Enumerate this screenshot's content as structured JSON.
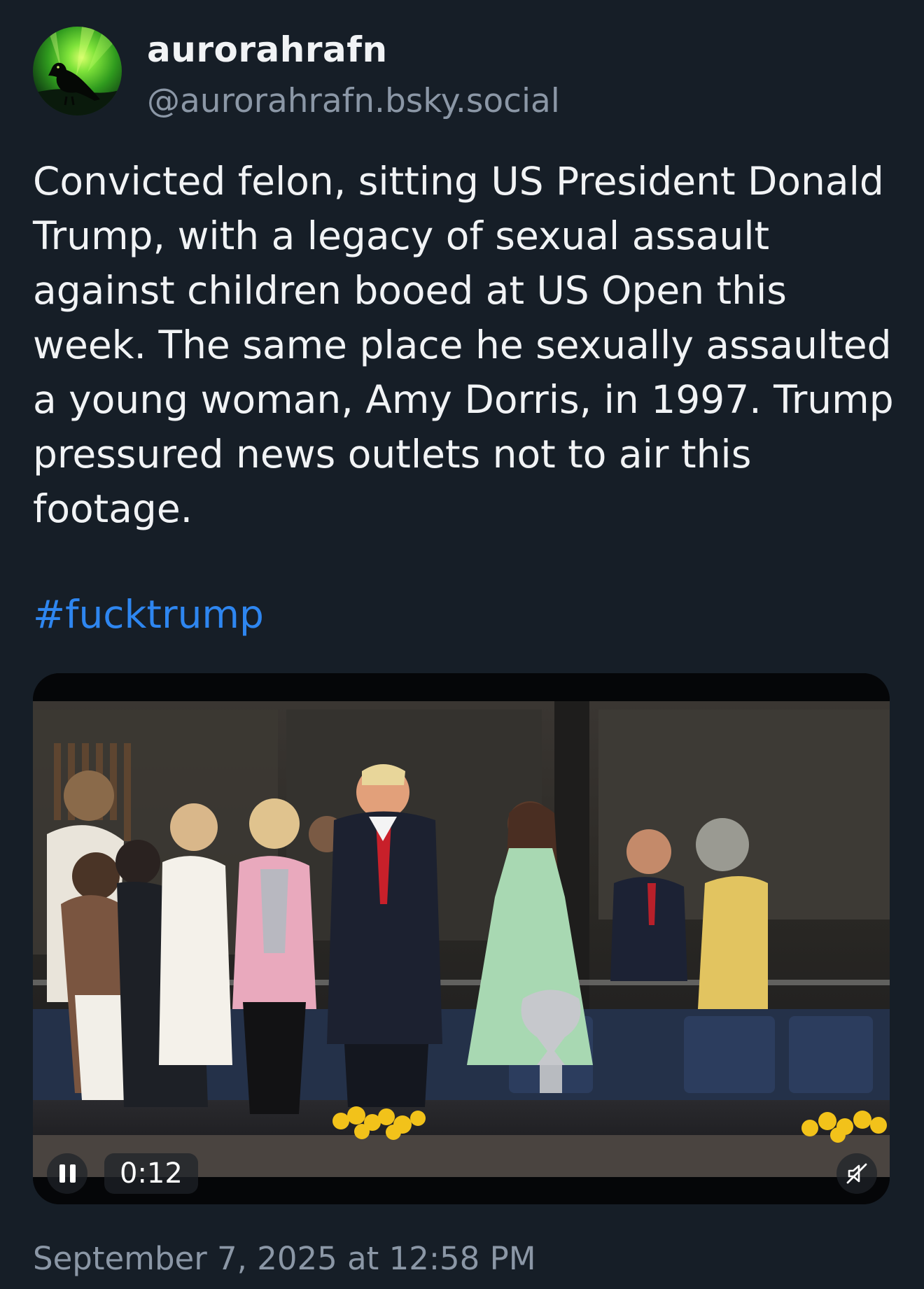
{
  "author": {
    "display_name": "aurorahrafn",
    "handle": "@aurorahrafn.bsky.social",
    "avatar_icon": "raven-aurora-avatar"
  },
  "post": {
    "text": "Convicted felon, sitting US President Donald Trump, with a legacy of sexual assault against children booed at US Open this week. The same place he sexually assaulted a young woman, Amy Dorris, in 1997. Trump pressured news outlets not to air this footage.",
    "hashtag": "#fucktrump",
    "timestamp": "September 7, 2025 at 12:58 PM"
  },
  "video": {
    "time": "0:12",
    "playback_state": "playing",
    "muted": true,
    "pause_icon": "pause-icon",
    "mute_icon": "muted-speaker-icon"
  },
  "colors": {
    "background": "#161e27",
    "text": "#f1f3f5",
    "secondary_text": "#8b97a6",
    "link": "#2e86f0"
  }
}
